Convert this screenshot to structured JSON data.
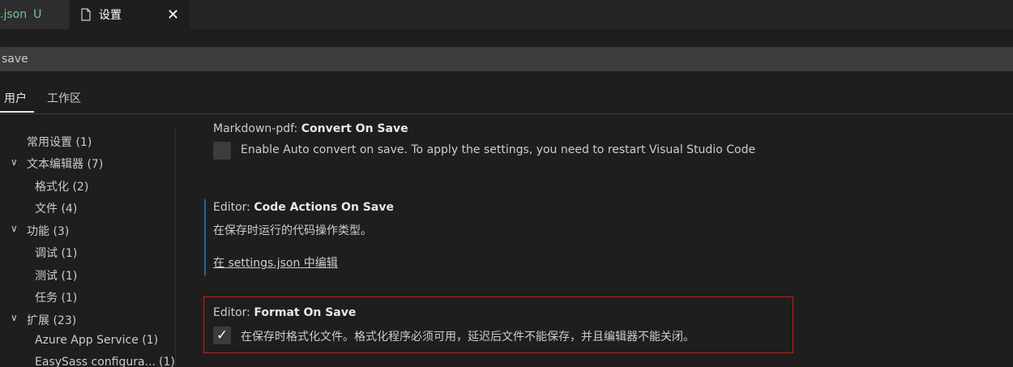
{
  "tabs": {
    "json_tab": {
      "name": ".json",
      "status": "U"
    },
    "settings_tab": {
      "title": "设置",
      "close": "✕"
    }
  },
  "search": {
    "value": "save"
  },
  "scopes": {
    "user": "用户",
    "workspace": "工作区"
  },
  "toc": {
    "common": "常用设置 (1)",
    "text_editor": "文本编辑器 (7)",
    "formatting": "格式化 (2)",
    "files": "文件 (4)",
    "features": "功能 (3)",
    "debug": "调试 (1)",
    "testing": "测试 (1)",
    "tasks": "任务 (1)",
    "extensions": "扩展 (23)",
    "azure": "Azure App Service (1)",
    "easysass": "EasySass configura...",
    "easysass_count": "(1)"
  },
  "settings": {
    "markdown_pdf": {
      "category": "Markdown-pdf: ",
      "key": "Convert On Save",
      "description": "Enable Auto convert on save. To apply the settings, you need to restart Visual Studio Code",
      "checked": false
    },
    "code_actions": {
      "category": "Editor: ",
      "key": "Code Actions On Save",
      "description": "在保存时运行的代码操作类型。",
      "link": "在 settings.json 中编辑"
    },
    "format_on_save": {
      "category": "Editor: ",
      "key": "Format On Save",
      "description": "在保存时格式化文件。格式化程序必须可用，延迟后文件不能保存，并且编辑器不能关闭。",
      "checked": true,
      "check_glyph": "✓"
    }
  }
}
